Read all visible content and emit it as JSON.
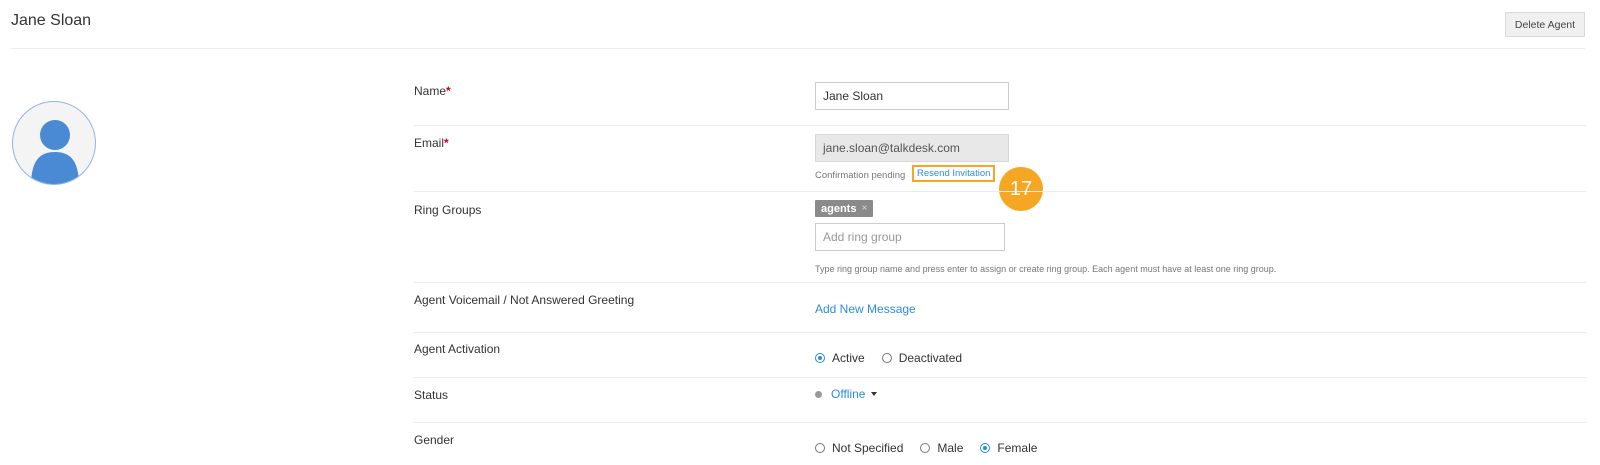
{
  "header": {
    "title": "Jane Sloan",
    "delete_label": "Delete Agent"
  },
  "avatar": {
    "icon": "user-silhouette-icon",
    "color": "#4a8ad4"
  },
  "form": {
    "name": {
      "label": "Name",
      "required_mark": "*",
      "value": "Jane Sloan"
    },
    "email": {
      "label": "Email",
      "required_mark": "*",
      "value": "jane.sloan@talkdesk.com",
      "status_text": "Confirmation pending",
      "resend_label": "Resend Invitation",
      "step_number": "17"
    },
    "ring_groups": {
      "label": "Ring Groups",
      "tags": [
        "agents"
      ],
      "tag_remove": "×",
      "placeholder": "Add ring group",
      "hint": "Type ring group name and press enter to assign or create ring group. Each agent must have at least one ring group."
    },
    "voicemail": {
      "label": "Agent Voicemail / Not Answered Greeting",
      "add_label": "Add New Message"
    },
    "activation": {
      "label": "Agent Activation",
      "options": [
        {
          "label": "Active",
          "checked": true
        },
        {
          "label": "Deactivated",
          "checked": false
        }
      ]
    },
    "status": {
      "label": "Status",
      "value": "Offline"
    },
    "gender": {
      "label": "Gender",
      "options": [
        {
          "label": "Not Specified",
          "checked": false
        },
        {
          "label": "Male",
          "checked": false
        },
        {
          "label": "Female",
          "checked": true
        }
      ]
    }
  },
  "colors": {
    "link": "#2b8ed8",
    "highlight": "#f5a623",
    "required": "#d0021b"
  }
}
